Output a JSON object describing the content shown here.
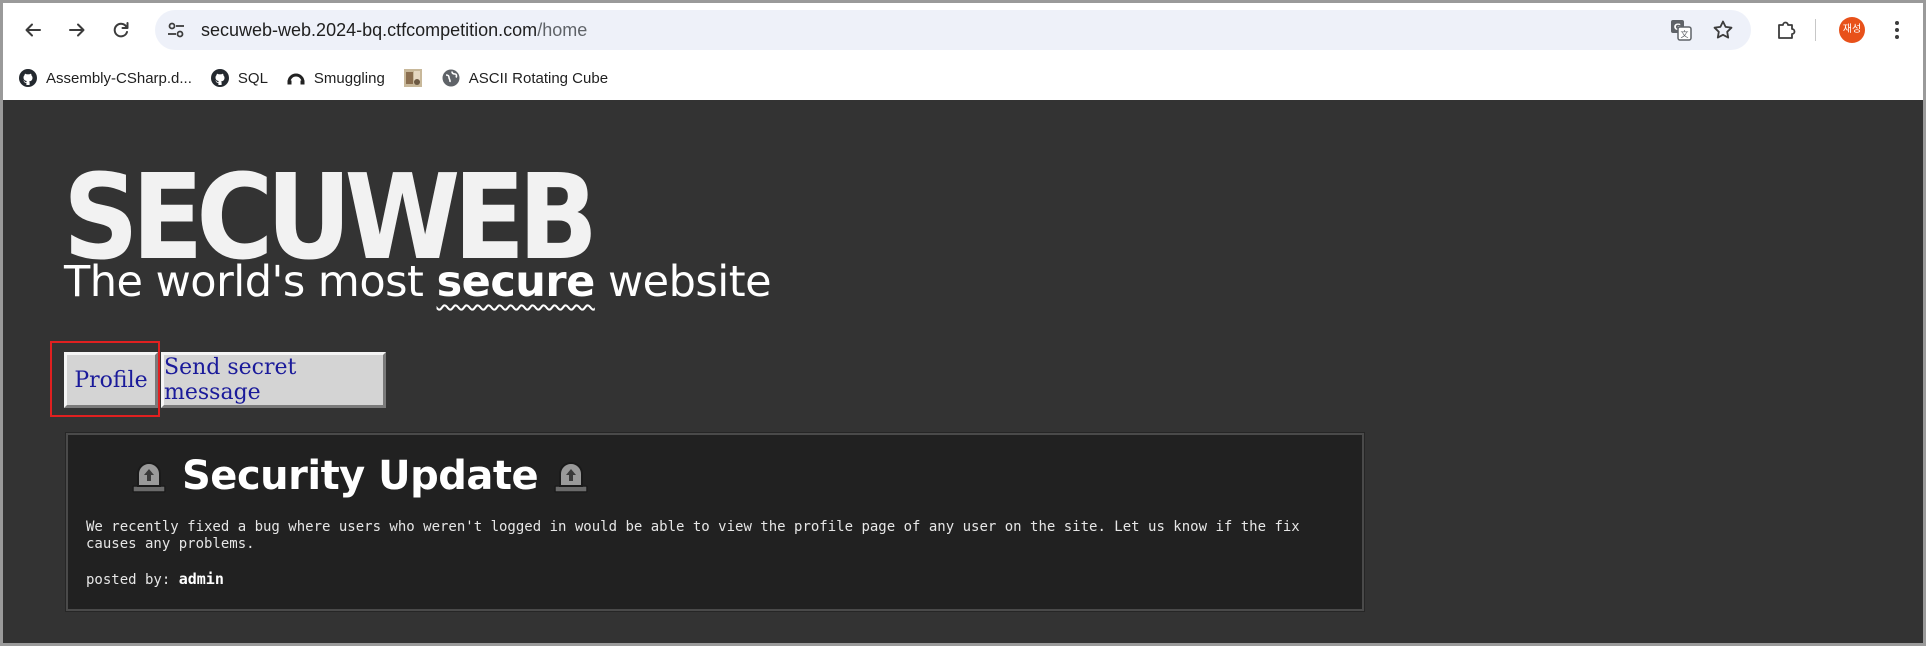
{
  "browser": {
    "url_host": "secuweb-web.2024-bq.ctfcompetition.com",
    "url_path": "/home",
    "profile_initials": "재성"
  },
  "bookmarks": [
    {
      "label": "Assembly-CSharp.d...",
      "icon": "github-icon"
    },
    {
      "label": "SQL",
      "icon": "github-icon"
    },
    {
      "label": "Smuggling",
      "icon": "rainbow-icon"
    },
    {
      "label": "",
      "icon": "thumbnail-image-icon"
    },
    {
      "label": "ASCII Rotating Cube",
      "icon": "globe-icon"
    }
  ],
  "site": {
    "logo_text": "SECUWEB",
    "tagline_before": "The world's most ",
    "tagline_emphasis": "secure",
    "tagline_after": " website",
    "nav": {
      "profile_label": "Profile",
      "secret_message_label": "Send secret message"
    }
  },
  "post": {
    "title": "Security Update",
    "body": "We recently fixed a bug where users who weren't logged in would be able to view the profile page of any user on the site. Let us know if the fix causes any problems.",
    "posted_by_label": "posted by: ",
    "author": "admin"
  },
  "colors": {
    "page_bg": "#333333",
    "post_bg": "#212121",
    "button_bg": "#d4d4d4",
    "button_text": "#1a1a9a",
    "highlight": "#e02020",
    "avatar": "#e8511a"
  }
}
